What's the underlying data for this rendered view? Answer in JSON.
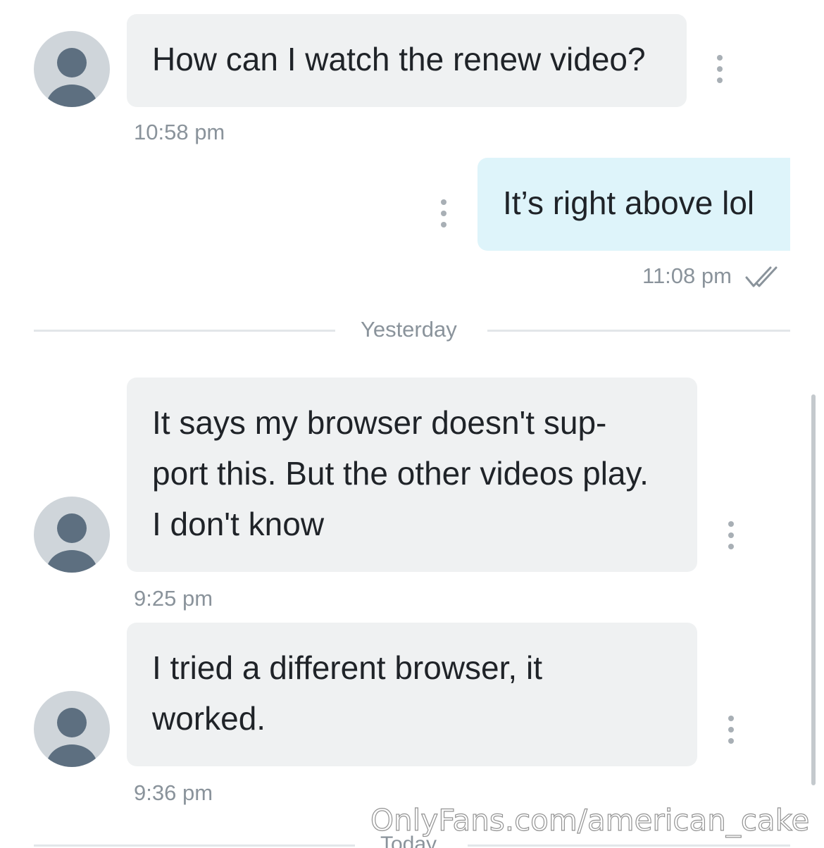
{
  "messages": [
    {
      "direction": "incoming",
      "text": "How can I watch the renew video?",
      "time": "10:58 pm"
    },
    {
      "direction": "outgoing",
      "text": "It’s right above lol",
      "time": "11:08 pm",
      "status_icon": "double-check-icon"
    },
    {
      "direction": "incoming",
      "text": "It says my browser doesn't sup-\nport this. But the other videos play.\nI don't know",
      "time": "9:25 pm"
    },
    {
      "direction": "incoming",
      "text": "I tried a different browser, it\nworked.",
      "time": "9:36 pm"
    }
  ],
  "day_separators": [
    "Yesterday",
    "Today"
  ],
  "watermark": "OnlyFans.com/american_cake",
  "colors": {
    "incoming_bubble": "#eff1f2",
    "outgoing_bubble": "#def4fa",
    "avatar_bg": "#cfd5da",
    "avatar_fg": "#5d6f80",
    "meta_text": "#8a939b"
  }
}
